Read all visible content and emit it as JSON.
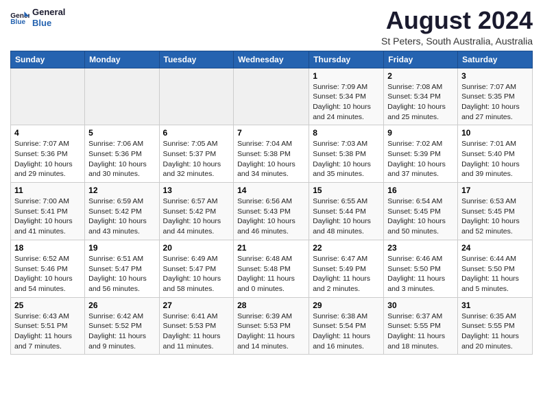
{
  "logo": {
    "line1": "General",
    "line2": "Blue"
  },
  "title": "August 2024",
  "location": "St Peters, South Australia, Australia",
  "weekdays": [
    "Sunday",
    "Monday",
    "Tuesday",
    "Wednesday",
    "Thursday",
    "Friday",
    "Saturday"
  ],
  "weeks": [
    [
      {
        "day": "",
        "info": ""
      },
      {
        "day": "",
        "info": ""
      },
      {
        "day": "",
        "info": ""
      },
      {
        "day": "",
        "info": ""
      },
      {
        "day": "1",
        "info": "Sunrise: 7:09 AM\nSunset: 5:34 PM\nDaylight: 10 hours\nand 24 minutes."
      },
      {
        "day": "2",
        "info": "Sunrise: 7:08 AM\nSunset: 5:34 PM\nDaylight: 10 hours\nand 25 minutes."
      },
      {
        "day": "3",
        "info": "Sunrise: 7:07 AM\nSunset: 5:35 PM\nDaylight: 10 hours\nand 27 minutes."
      }
    ],
    [
      {
        "day": "4",
        "info": "Sunrise: 7:07 AM\nSunset: 5:36 PM\nDaylight: 10 hours\nand 29 minutes."
      },
      {
        "day": "5",
        "info": "Sunrise: 7:06 AM\nSunset: 5:36 PM\nDaylight: 10 hours\nand 30 minutes."
      },
      {
        "day": "6",
        "info": "Sunrise: 7:05 AM\nSunset: 5:37 PM\nDaylight: 10 hours\nand 32 minutes."
      },
      {
        "day": "7",
        "info": "Sunrise: 7:04 AM\nSunset: 5:38 PM\nDaylight: 10 hours\nand 34 minutes."
      },
      {
        "day": "8",
        "info": "Sunrise: 7:03 AM\nSunset: 5:38 PM\nDaylight: 10 hours\nand 35 minutes."
      },
      {
        "day": "9",
        "info": "Sunrise: 7:02 AM\nSunset: 5:39 PM\nDaylight: 10 hours\nand 37 minutes."
      },
      {
        "day": "10",
        "info": "Sunrise: 7:01 AM\nSunset: 5:40 PM\nDaylight: 10 hours\nand 39 minutes."
      }
    ],
    [
      {
        "day": "11",
        "info": "Sunrise: 7:00 AM\nSunset: 5:41 PM\nDaylight: 10 hours\nand 41 minutes."
      },
      {
        "day": "12",
        "info": "Sunrise: 6:59 AM\nSunset: 5:42 PM\nDaylight: 10 hours\nand 43 minutes."
      },
      {
        "day": "13",
        "info": "Sunrise: 6:57 AM\nSunset: 5:42 PM\nDaylight: 10 hours\nand 44 minutes."
      },
      {
        "day": "14",
        "info": "Sunrise: 6:56 AM\nSunset: 5:43 PM\nDaylight: 10 hours\nand 46 minutes."
      },
      {
        "day": "15",
        "info": "Sunrise: 6:55 AM\nSunset: 5:44 PM\nDaylight: 10 hours\nand 48 minutes."
      },
      {
        "day": "16",
        "info": "Sunrise: 6:54 AM\nSunset: 5:45 PM\nDaylight: 10 hours\nand 50 minutes."
      },
      {
        "day": "17",
        "info": "Sunrise: 6:53 AM\nSunset: 5:45 PM\nDaylight: 10 hours\nand 52 minutes."
      }
    ],
    [
      {
        "day": "18",
        "info": "Sunrise: 6:52 AM\nSunset: 5:46 PM\nDaylight: 10 hours\nand 54 minutes."
      },
      {
        "day": "19",
        "info": "Sunrise: 6:51 AM\nSunset: 5:47 PM\nDaylight: 10 hours\nand 56 minutes."
      },
      {
        "day": "20",
        "info": "Sunrise: 6:49 AM\nSunset: 5:47 PM\nDaylight: 10 hours\nand 58 minutes."
      },
      {
        "day": "21",
        "info": "Sunrise: 6:48 AM\nSunset: 5:48 PM\nDaylight: 11 hours\nand 0 minutes."
      },
      {
        "day": "22",
        "info": "Sunrise: 6:47 AM\nSunset: 5:49 PM\nDaylight: 11 hours\nand 2 minutes."
      },
      {
        "day": "23",
        "info": "Sunrise: 6:46 AM\nSunset: 5:50 PM\nDaylight: 11 hours\nand 3 minutes."
      },
      {
        "day": "24",
        "info": "Sunrise: 6:44 AM\nSunset: 5:50 PM\nDaylight: 11 hours\nand 5 minutes."
      }
    ],
    [
      {
        "day": "25",
        "info": "Sunrise: 6:43 AM\nSunset: 5:51 PM\nDaylight: 11 hours\nand 7 minutes."
      },
      {
        "day": "26",
        "info": "Sunrise: 6:42 AM\nSunset: 5:52 PM\nDaylight: 11 hours\nand 9 minutes."
      },
      {
        "day": "27",
        "info": "Sunrise: 6:41 AM\nSunset: 5:53 PM\nDaylight: 11 hours\nand 11 minutes."
      },
      {
        "day": "28",
        "info": "Sunrise: 6:39 AM\nSunset: 5:53 PM\nDaylight: 11 hours\nand 14 minutes."
      },
      {
        "day": "29",
        "info": "Sunrise: 6:38 AM\nSunset: 5:54 PM\nDaylight: 11 hours\nand 16 minutes."
      },
      {
        "day": "30",
        "info": "Sunrise: 6:37 AM\nSunset: 5:55 PM\nDaylight: 11 hours\nand 18 minutes."
      },
      {
        "day": "31",
        "info": "Sunrise: 6:35 AM\nSunset: 5:55 PM\nDaylight: 11 hours\nand 20 minutes."
      }
    ]
  ]
}
